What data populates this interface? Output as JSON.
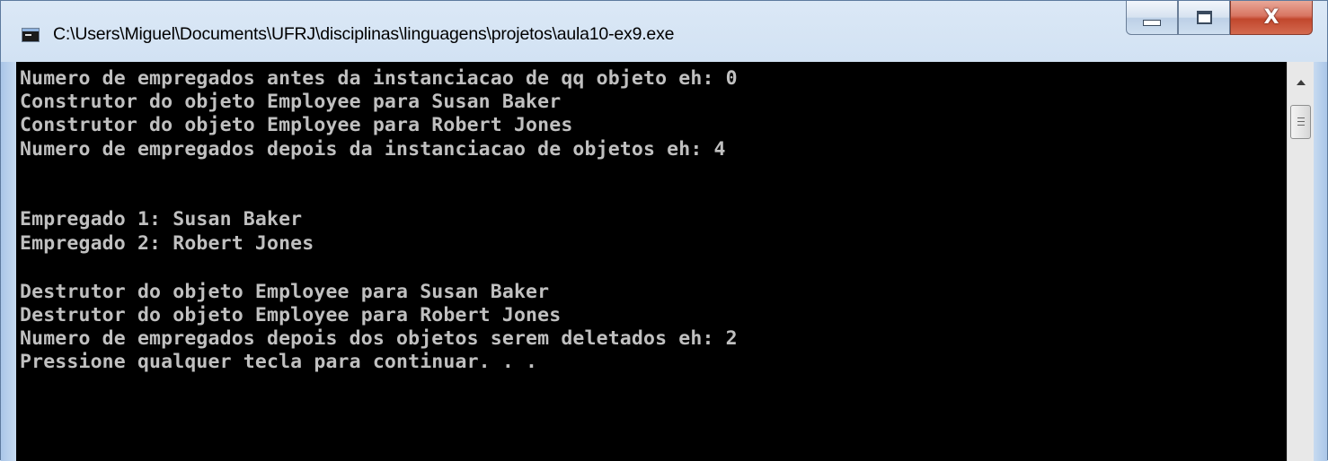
{
  "window": {
    "title": "C:\\Users\\Miguel\\Documents\\UFRJ\\disciplinas\\linguagens\\projetos\\aula10-ex9.exe",
    "icon": "console-app-icon",
    "controls": {
      "minimize_icon": "minimize-icon",
      "maximize_icon": "maximize-icon",
      "close_icon": "close-icon",
      "close_glyph": "X",
      "close_color": "#c2472d"
    }
  },
  "console": {
    "background": "#000000",
    "text_color": "#c0c0c0",
    "lines": [
      "Numero de empregados antes da instanciacao de qq objeto eh: 0",
      "Construtor do objeto Employee para Susan Baker",
      "Construtor do objeto Employee para Robert Jones",
      "Numero de empregados depois da instanciacao de objetos eh: 4",
      "",
      "",
      "Empregado 1: Susan Baker",
      "Empregado 2: Robert Jones",
      "",
      "Destrutor do objeto Employee para Susan Baker",
      "Destrutor do objeto Employee para Robert Jones",
      "Numero de empregados depois dos objetos serem deletados eh: 2",
      "Pressione qualquer tecla para continuar. . ."
    ]
  },
  "scrollbar": {
    "up_arrow_icon": "scroll-up-arrow-icon",
    "thumb_icon": "scroll-thumb-grip-icon"
  }
}
